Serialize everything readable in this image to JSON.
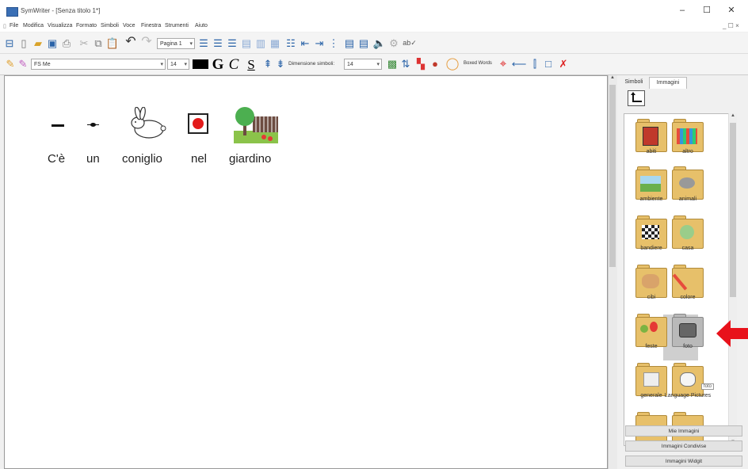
{
  "window": {
    "title": "SymWriter - [Senza titolo 1*]",
    "minimize": "–",
    "maximize": "☐",
    "close": "✕"
  },
  "menu": {
    "items": [
      "File",
      "Modifica",
      "Visualizza",
      "Formato",
      "Simboli",
      "Voce",
      "Finestra",
      "Strumenti",
      "Aiuto"
    ],
    "mdi_controls": "_ ☐ ×"
  },
  "toolbar1": {
    "page_selector": "Pagina 1"
  },
  "toolbar2": {
    "font_name": "FS Me",
    "font_size": "14",
    "symbol_size_label": "Dimensione simboli:",
    "symbol_size": "14",
    "boxed_words": "Boxed Words",
    "bold_glyph": "G",
    "italic_glyph": "C",
    "underline_glyph": "S"
  },
  "document": {
    "symbols": [
      {
        "word": "C'è"
      },
      {
        "word": "un"
      },
      {
        "word": "coniglio"
      },
      {
        "word": "nel"
      },
      {
        "word": "giardino"
      }
    ]
  },
  "panel": {
    "tabs": [
      "Simboli",
      "Immagini"
    ],
    "active_tab": "Immagini",
    "folders": [
      "abiti",
      "altro",
      "ambiente",
      "animali",
      "bandiere",
      "casa",
      "cibi",
      "colore",
      "feste",
      "foto",
      "generale",
      "Language Pictures"
    ],
    "selected_folder": "foto",
    "tooltip": "foto",
    "buttons": [
      "Mie Immagini",
      "Immagini Condivise",
      "Immagini Widgit"
    ]
  },
  "colors": {
    "accent_arrow": "#e8121b",
    "folder": "#e7c06a"
  }
}
